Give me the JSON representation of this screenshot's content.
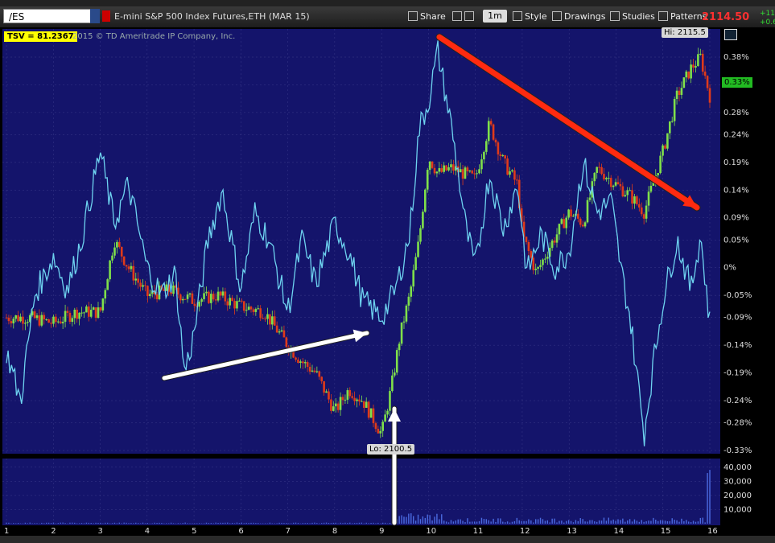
{
  "toolbar": {
    "symbol": "/ES",
    "instrument": "E-mini S&P 500 Index Futures,ETH (MAR 15)",
    "share": "Share",
    "timeframe": "1m",
    "style": "Style",
    "drawings": "Drawings",
    "studies": "Studies",
    "patterns": "Patterns",
    "last_price": "2114.50",
    "change_1": "+11.",
    "change_2": "+0.6"
  },
  "labels": {
    "study": "TSV = 81.2367",
    "copyright": "2015 © TD Ameritrade IP Company, Inc.",
    "high": "Hi: 2115.5",
    "low": "Lo: 2100.5",
    "current_pct": "0.33%"
  },
  "colors": {
    "background": "#14146b",
    "grid": "#3a3a8a",
    "candle_up": "#7fe04a",
    "candle_down": "#e03a1a",
    "tsv_line": "#6ed3f0",
    "arrow_red": "#ff2a10",
    "arrow_white": "#ffffff",
    "volume": "#4a6ae0"
  },
  "chart_data": [
    {
      "type": "line",
      "title": "",
      "description_series": "Price (candles, percent change) with TSV overlay",
      "y_ticks": [
        "0.38%",
        "0.33%",
        "0.28%",
        "0.24%",
        "0.19%",
        "0.14%",
        "0.09%",
        "0.05%",
        "0%",
        "-0.05%",
        "-0.09%",
        "-0.14%",
        "-0.19%",
        "-0.24%",
        "-0.28%",
        "-0.33%"
      ],
      "ylim": [
        -0.33,
        0.38
      ],
      "x_ticks": [
        "1",
        "2",
        "3",
        "4",
        "5",
        "6",
        "7",
        "8",
        "9",
        "10",
        "11",
        "12",
        "13",
        "14",
        "15",
        "16"
      ],
      "price_series": {
        "x": [
          1,
          1.5,
          2,
          2.5,
          3,
          3.3,
          3.6,
          4,
          4.5,
          5,
          5.5,
          6,
          6.5,
          7,
          7.3,
          7.6,
          8,
          8.3,
          8.6,
          9,
          9.2,
          9.4,
          9.6,
          9.8,
          10,
          10.2,
          10.5,
          11,
          11.3,
          11.6,
          11.9,
          12,
          12.3,
          12.6,
          13,
          13.3,
          13.6,
          14,
          14.3,
          14.6,
          15,
          15.3,
          15.6,
          15.8,
          16
        ],
        "y": [
          -0.09,
          -0.09,
          -0.1,
          -0.08,
          -0.08,
          0.05,
          0.0,
          -0.05,
          -0.04,
          -0.06,
          -0.05,
          -0.07,
          -0.08,
          -0.14,
          -0.17,
          -0.19,
          -0.26,
          -0.22,
          -0.24,
          -0.3,
          -0.22,
          -0.12,
          -0.05,
          0.05,
          0.2,
          0.17,
          0.18,
          0.16,
          0.26,
          0.19,
          0.15,
          0.06,
          -0.01,
          0.04,
          0.1,
          0.08,
          0.18,
          0.15,
          0.13,
          0.1,
          0.21,
          0.31,
          0.36,
          0.38,
          0.31
        ]
      },
      "tsv_series": {
        "x": [
          1,
          1.3,
          1.6,
          2,
          2.3,
          2.6,
          3,
          3.3,
          3.6,
          4,
          4.3,
          4.6,
          4.8,
          5,
          5.3,
          5.6,
          6,
          6.3,
          6.6,
          7,
          7.3,
          7.6,
          8,
          8.3,
          8.6,
          9,
          9.3,
          9.6,
          9.8,
          10,
          10.2,
          10.5,
          10.8,
          11,
          11.3,
          11.6,
          11.9,
          12.1,
          12.4,
          12.7,
          13,
          13.3,
          13.6,
          13.9,
          14.1,
          14.3,
          14.6,
          14.8,
          15,
          15.3,
          15.6,
          15.8,
          16
        ],
        "y": [
          -0.15,
          -0.24,
          -0.05,
          0.02,
          -0.04,
          0.05,
          0.21,
          0.08,
          0.15,
          0.0,
          -0.05,
          -0.01,
          -0.19,
          -0.12,
          0.05,
          0.14,
          -0.04,
          0.1,
          0.05,
          -0.08,
          0.05,
          -0.03,
          0.08,
          0.03,
          -0.06,
          -0.09,
          -0.04,
          0.06,
          0.25,
          0.3,
          0.39,
          0.25,
          0.07,
          0.0,
          0.17,
          0.07,
          0.15,
          -0.01,
          0.06,
          0.0,
          0.03,
          0.19,
          0.1,
          0.12,
          0.0,
          -0.09,
          -0.3,
          -0.17,
          -0.06,
          0.05,
          -0.04,
          0.06,
          -0.1
        ]
      }
    },
    {
      "type": "bar",
      "title": "",
      "y_ticks": [
        "40,000",
        "30,000",
        "20,000",
        "10,000"
      ],
      "ylim": [
        0,
        45000
      ]
    }
  ]
}
